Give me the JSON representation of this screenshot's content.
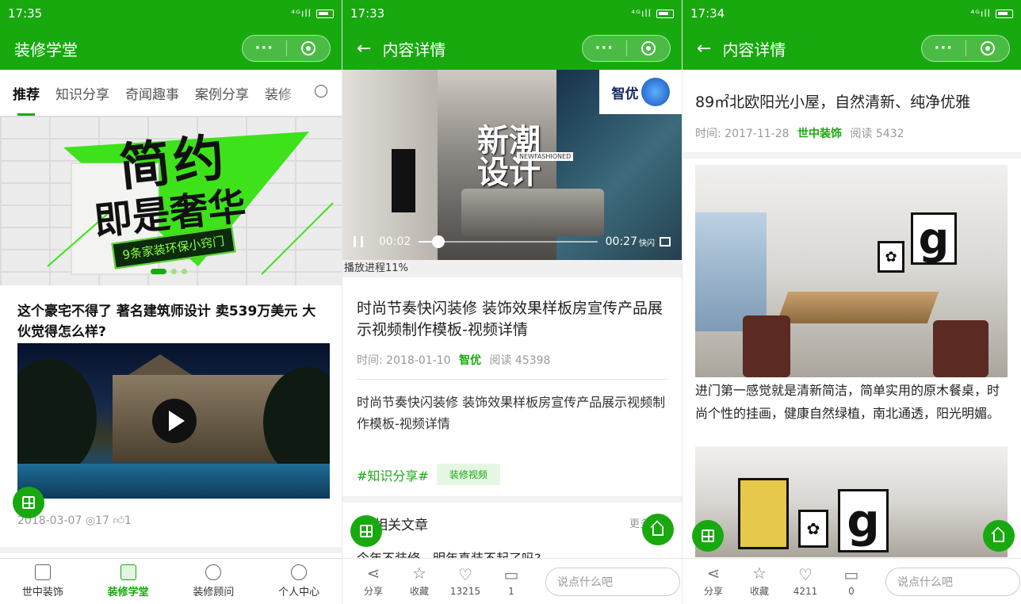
{
  "colors": {
    "brand": "#18a90f"
  },
  "screens": {
    "home": {
      "status": {
        "time": "17:35",
        "signal": "⁴ᴳıll"
      },
      "nav_title": "装修学堂",
      "tabs": [
        "推荐",
        "知识分享",
        "奇闻趣事",
        "案例分享",
        "装修"
      ],
      "banner": {
        "line1": "简约",
        "line2_a": "即是",
        "line2_b": "奢华",
        "strip": "9条家装环保小窍门"
      },
      "headline": "这个豪宅不得了 著名建筑师设计 卖539万美元 大伙觉得怎么样?",
      "meta": {
        "date": "2018-03-07",
        "views": "17",
        "likes": "1"
      },
      "tabbar": [
        {
          "label": "世中装饰",
          "icon": "building-icon"
        },
        {
          "label": "装修学堂",
          "icon": "video-play-icon"
        },
        {
          "label": "装修顾问",
          "icon": "advisor-icon"
        },
        {
          "label": "个人中心",
          "icon": "user-icon"
        }
      ]
    },
    "video_detail": {
      "status": {
        "time": "17:33",
        "signal": "⁴ᴳıll"
      },
      "nav_title": "内容详情",
      "player": {
        "overlay_line1": "新潮",
        "overlay_line2": "设计",
        "overlay_sub": "NEWFASHIONED",
        "logo_text": "智优",
        "current": "00:02",
        "duration": "00:27",
        "quick_label": "快闪",
        "progress": 0.11
      },
      "progress_label": "播放进程11%",
      "title": "时尚节奏快闪装修 装饰效果样板房宣传产品展示视频制作模板-视频详情",
      "meta": {
        "time_label": "时间:",
        "date": "2018-01-10",
        "source": "智优",
        "read_label": "阅读",
        "read_count": "45398"
      },
      "body": "时尚节奏快闪装修 装饰效果样板房宣传产品展示视频制作模板-视频详情",
      "tag_hash": "#知识分享#",
      "tag_chip": "装修视频",
      "related_title": "相关文章",
      "more": "更多",
      "related_next": "今年不装修，明年真装不起了吗?",
      "actions": {
        "share": "分享",
        "favorite": "收藏",
        "likes": "13215",
        "comments": "1"
      },
      "comment_placeholder": "说点什么吧"
    },
    "article_detail": {
      "status": {
        "time": "17:34",
        "signal": "⁴ᴳıll"
      },
      "nav_title": "内容详情",
      "title": "89㎡北欧阳光小屋，自然清新、纯净优雅",
      "meta": {
        "time_label": "时间:",
        "date": "2017-11-28",
        "source": "世中装饰",
        "read_label": "阅读",
        "read_count": "5432"
      },
      "body": "进门第一感觉就是清新简洁，简单实用的原木餐桌，时尚个性的挂画，健康自然绿植，南北通透，阳光明媚。",
      "frame_letter": "g",
      "actions": {
        "share": "分享",
        "favorite": "收藏",
        "likes": "4211",
        "comments": "0"
      },
      "comment_placeholder": "说点什么吧"
    }
  }
}
